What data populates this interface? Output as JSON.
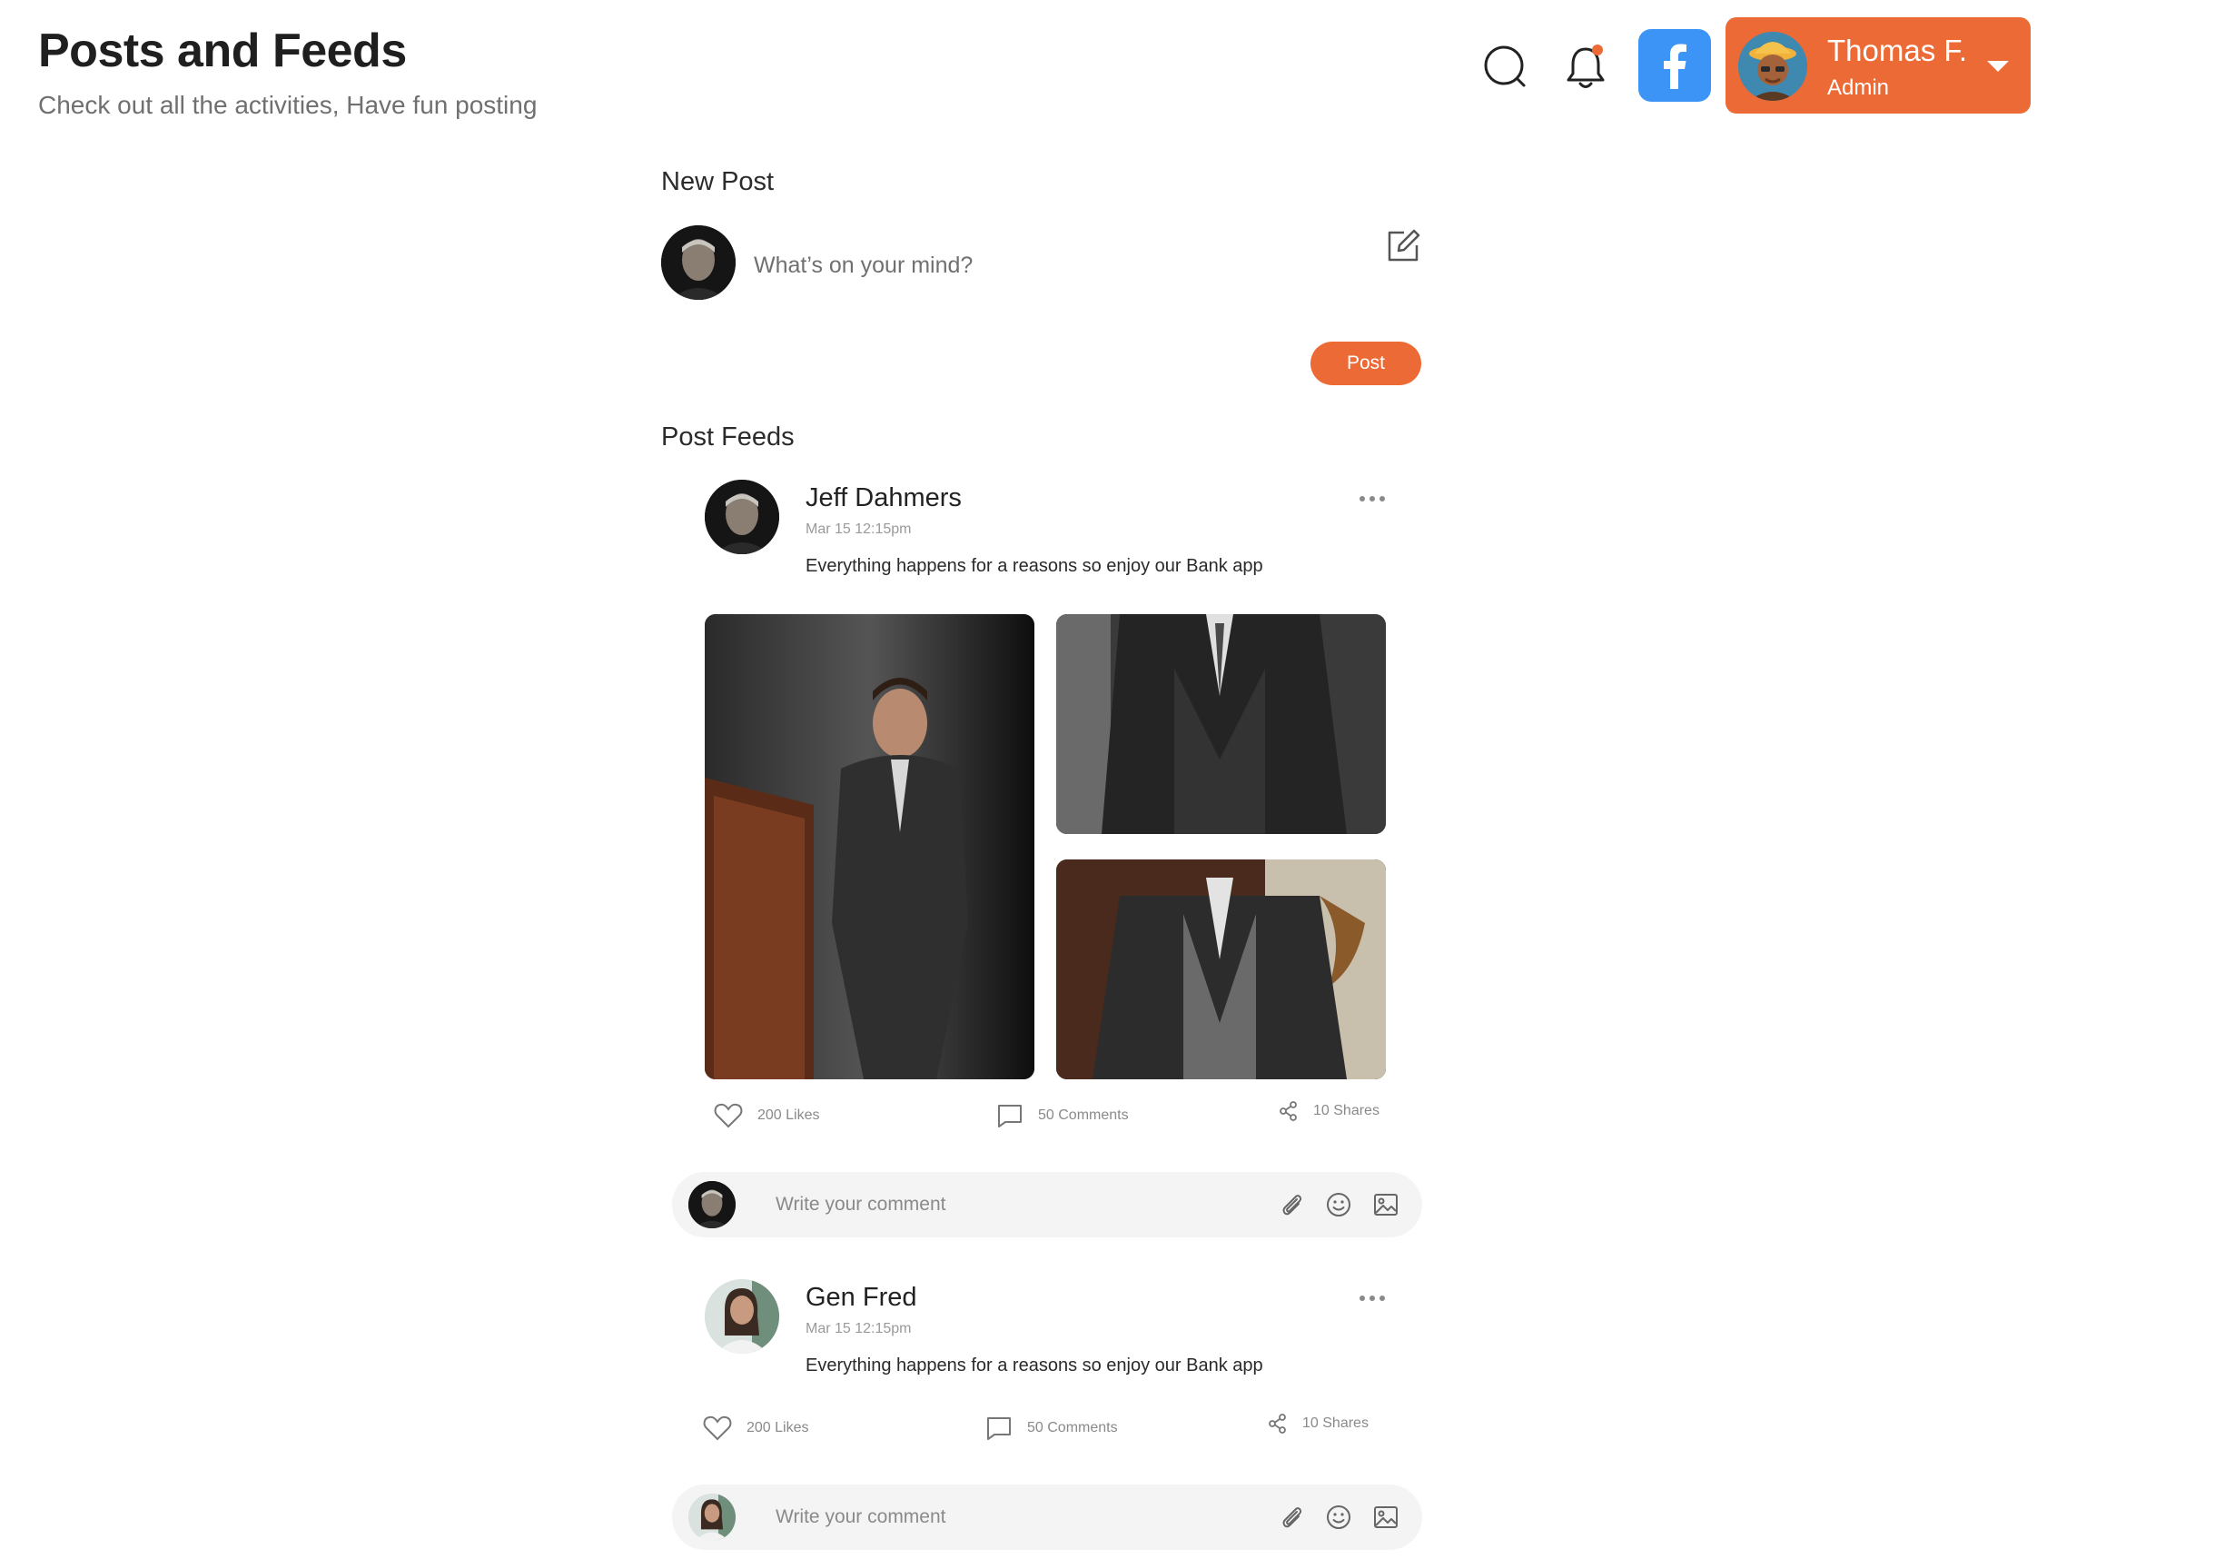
{
  "header": {
    "title": "Posts and Feeds",
    "subtitle": "Check out all the activities, Have fun posting"
  },
  "topbar": {
    "search_icon": "search-icon",
    "notification_icon": "bell-icon",
    "notification_dot_color": "#ec6a35",
    "facebook_icon": "facebook-icon",
    "facebook_color": "#3b94f6",
    "profile": {
      "name": "Thomas F.",
      "role": "Admin",
      "accent": "#ec6a35"
    }
  },
  "new_post": {
    "title": "New Post",
    "placeholder": "What’s on your mind?",
    "post_button": "Post"
  },
  "feeds": {
    "title": "Post Feeds",
    "posts": [
      {
        "author": "Jeff Dahmers",
        "time": "Mar 15 12:15pm",
        "text": "Everything happens for a reasons so enjoy our Bank app",
        "likes": "200 Likes",
        "comments": "50 Comments",
        "shares": "10 Shares",
        "comment_placeholder": "Write your comment"
      },
      {
        "author": "Gen Fred",
        "time": "Mar 15 12:15pm",
        "text": "Everything happens for a reasons so enjoy our Bank app",
        "likes": "200 Likes",
        "comments": "50 Comments",
        "shares": "10 Shares",
        "comment_placeholder": "Write your comment"
      }
    ]
  }
}
